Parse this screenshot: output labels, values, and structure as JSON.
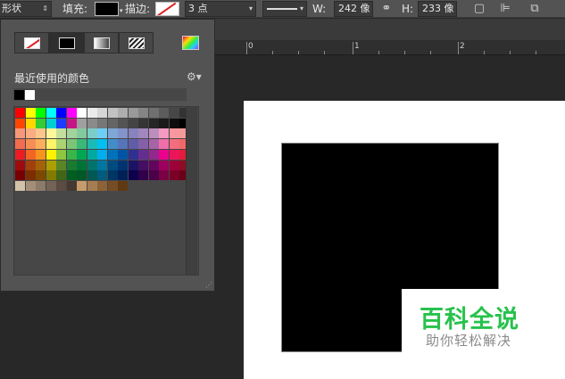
{
  "options_bar": {
    "mode_label": "形状",
    "fill_label": "填充:",
    "stroke_label": "描边:",
    "stroke_width": "3 点",
    "w_label": "W:",
    "w_value": "242 像",
    "h_label": "H:",
    "h_value": "233 像"
  },
  "ruler": {
    "marks": [
      "0",
      "1",
      "2"
    ]
  },
  "panel": {
    "recent_label": "最近使用的颜色",
    "recent_colors": [
      "#000000",
      "#ffffff"
    ],
    "swatch_rows": [
      [
        "#ff0000",
        "#ffff00",
        "#00ff00",
        "#00ffff",
        "#0000ff",
        "#ff00ff",
        "#ffffff",
        "#ebebeb",
        "#d6d6d6",
        "#c2c2c2",
        "#adadad",
        "#999999",
        "#858585",
        "#707070",
        "#5c5c5c",
        "#474747",
        "#333333"
      ],
      [
        "#ff4500",
        "#ffd700",
        "#32cd32",
        "#00ced1",
        "#1e3cff",
        "#c71585",
        "#9f9f9f",
        "#8a8a8a",
        "#777777",
        "#656565",
        "#545454",
        "#444444",
        "#353535",
        "#262626",
        "#1a1a1a",
        "#0d0d0d",
        "#000000"
      ],
      [
        "#f7977a",
        "#f9ad81",
        "#fdc68a",
        "#fff79a",
        "#c4df9b",
        "#a2d39c",
        "#82ca9d",
        "#7bcdc8",
        "#6ecff6",
        "#7ea7d8",
        "#8493ca",
        "#8882be",
        "#a187be",
        "#bc8dbf",
        "#f49ac2",
        "#f6989d",
        "#f49a9a"
      ],
      [
        "#f26c4f",
        "#f68e55",
        "#fbaf5c",
        "#fff467",
        "#acd372",
        "#7cc576",
        "#3bb878",
        "#1abbb4",
        "#00bff3",
        "#438cca",
        "#5574b9",
        "#605ca8",
        "#855fa8",
        "#a763a8",
        "#f06ea9",
        "#f26d7d",
        "#f06767"
      ],
      [
        "#ed1c24",
        "#f26522",
        "#f7941d",
        "#fff200",
        "#8dc73f",
        "#39b54a",
        "#00a651",
        "#00a99d",
        "#00aeef",
        "#0072bc",
        "#0054a6",
        "#2e3192",
        "#662d91",
        "#92278f",
        "#ec008c",
        "#ed145b",
        "#e11c3c"
      ],
      [
        "#9e0b0f",
        "#a0410d",
        "#a36209",
        "#aba000",
        "#598527",
        "#1a7b30",
        "#007236",
        "#00746b",
        "#0076a3",
        "#004b80",
        "#003471",
        "#1b1464",
        "#440e62",
        "#630460",
        "#9e005d",
        "#9e0039",
        "#8e0c24"
      ],
      [
        "#790000",
        "#7b2e00",
        "#7d4900",
        "#827b00",
        "#406618",
        "#005e20",
        "#005826",
        "#005952",
        "#005b7f",
        "#003663",
        "#002157",
        "#0d004c",
        "#32004b",
        "#4b0049",
        "#7b0046",
        "#7a0026",
        "#6b0018"
      ],
      [
        "#d2c2a8",
        "#a38f77",
        "#8c7b6b",
        "#736357",
        "#5c4b43",
        "#463931",
        "#c69c6d",
        "#a67c52",
        "#8c6239",
        "#754c24",
        "#603913"
      ]
    ]
  },
  "watermark": {
    "title": "百科全说",
    "subtitle": "助你轻松解决"
  }
}
